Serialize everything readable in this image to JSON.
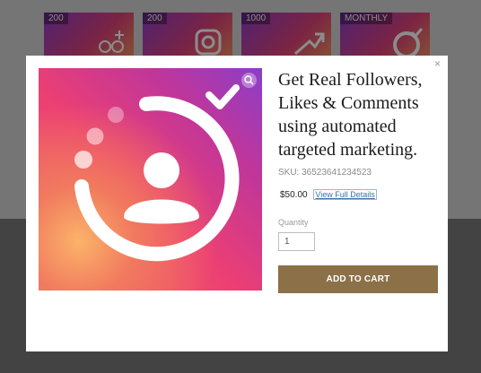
{
  "background_tiles": [
    {
      "badge": "200"
    },
    {
      "badge": "200"
    },
    {
      "badge": "1000"
    },
    {
      "badge": "MONTHLY"
    }
  ],
  "modal": {
    "close_label": "×",
    "image_icon": "instagram-follower-icon",
    "zoom_icon": "magnifier-icon",
    "title": "Get Real Followers, Likes & Comments using automated targeted marketing.",
    "sku": "SKU: 36523641234523",
    "price": "$50.00",
    "details_link": "View Full Details",
    "quantity_label": "Quantity",
    "quantity_value": "1",
    "add_to_cart": "ADD TO CART"
  },
  "colors": {
    "button": "#8c7048",
    "overlay": "rgba(0,0,0,0.45)",
    "gradient": [
      "#f7a45a",
      "#e0427a",
      "#8f3fd0"
    ]
  }
}
